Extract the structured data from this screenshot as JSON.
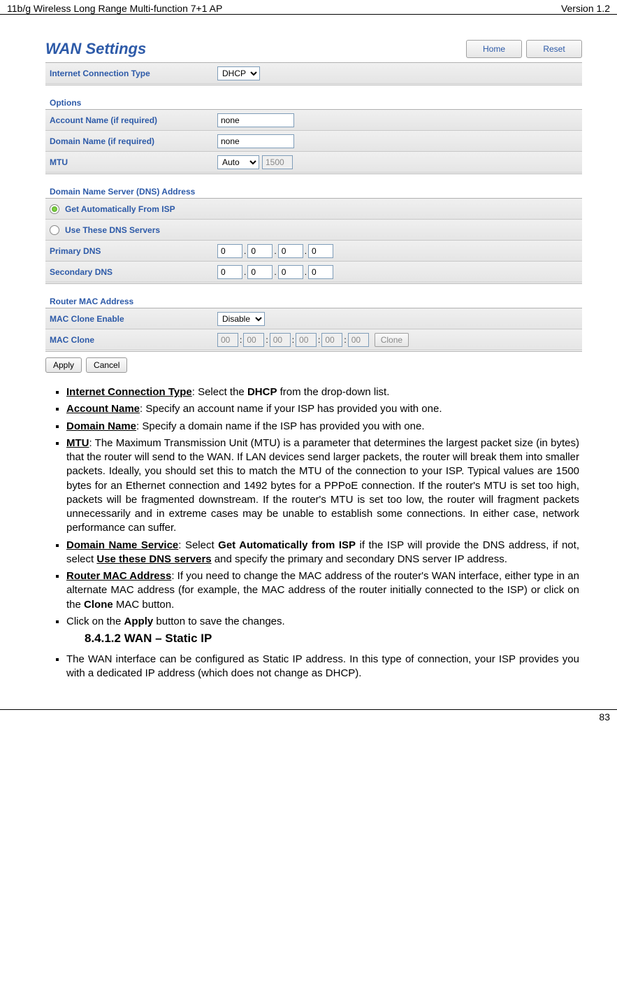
{
  "doc_header": {
    "left": "11b/g Wireless Long Range Multi-function 7+1 AP",
    "right": "Version 1.2"
  },
  "panel": {
    "title": "WAN Settings",
    "buttons": {
      "home": "Home",
      "reset": "Reset"
    },
    "ict": {
      "label": "Internet Connection Type",
      "value": "DHCP"
    },
    "options_header": "Options",
    "account": {
      "label": "Account Name (if required)",
      "value": "none"
    },
    "domain": {
      "label": "Domain Name (if required)",
      "value": "none"
    },
    "mtu": {
      "label": "MTU",
      "mode": "Auto",
      "value": "1500"
    },
    "dns_header": "Domain Name Server (DNS) Address",
    "dns_radio1": "Get Automatically From ISP",
    "dns_radio2": "Use These DNS Servers",
    "primary_dns": {
      "label": "Primary DNS",
      "a": "0",
      "b": "0",
      "c": "0",
      "d": "0"
    },
    "secondary_dns": {
      "label": "Secondary DNS",
      "a": "0",
      "b": "0",
      "c": "0",
      "d": "0"
    },
    "router_mac_header": "Router MAC Address",
    "mac_enable": {
      "label": "MAC Clone Enable",
      "value": "Disable"
    },
    "mac_clone": {
      "label": "MAC Clone",
      "a": "00",
      "b": "00",
      "c": "00",
      "d": "00",
      "e": "00",
      "f": "00",
      "btn": "Clone"
    },
    "apply": "Apply",
    "cancel": "Cancel"
  },
  "body": {
    "li1_b": "Internet Connection Type",
    "li1_t": ": Select the ",
    "li1_b2": "DHCP",
    "li1_t2": " from the drop-down list.",
    "li2_b": "Account Name",
    "li2_t": ": Specify an account name if your ISP has provided you with one.",
    "li3_b": "Domain Name",
    "li3_t": ": Specify a domain name if the ISP has provided you with one.",
    "li4_b": "MTU",
    "li4_t": ": The Maximum Transmission Unit (MTU) is a parameter that determines the largest packet size (in bytes) that the router will send to the WAN. If LAN devices send larger packets, the router will break them into smaller packets. Ideally, you should set this to match the MTU of the connection to your ISP. Typical values are 1500 bytes for an Ethernet connection and 1492 bytes for a PPPoE connection. If the router's MTU is set too high, packets will be fragmented downstream. If the router's MTU is set too low, the router will fragment packets unnecessarily and in extreme cases may be unable to establish some connections. In either case, network performance can suffer.",
    "li5_b": "Domain Name Service",
    "li5_t": ": Select ",
    "li5_b2": "Get Automatically from ISP",
    "li5_t2": " if the ISP will provide the DNS address, if not, select ",
    "li5_b3": "Use these DNS servers",
    "li5_t3": " and specify the primary and secondary DNS server IP address.",
    "li6_b": "Router MAC Address",
    "li6_t": ": If you need to change the MAC address of the router's WAN interface, either type in an alternate MAC address (for example, the MAC address of the router initially connected to the ISP) or click on the ",
    "li6_b2": "Clone",
    "li6_t2": " MAC button.",
    "li7_t": "Click on the ",
    "li7_b": "Apply",
    "li7_t2": " button to save the changes.",
    "subheading": "8.4.1.2     WAN – Static IP",
    "li8_t": "The WAN interface can be configured as Static IP address. In this type of connection, your ISP provides you with a dedicated IP address (which does not change as DHCP)."
  },
  "page_no": "83"
}
